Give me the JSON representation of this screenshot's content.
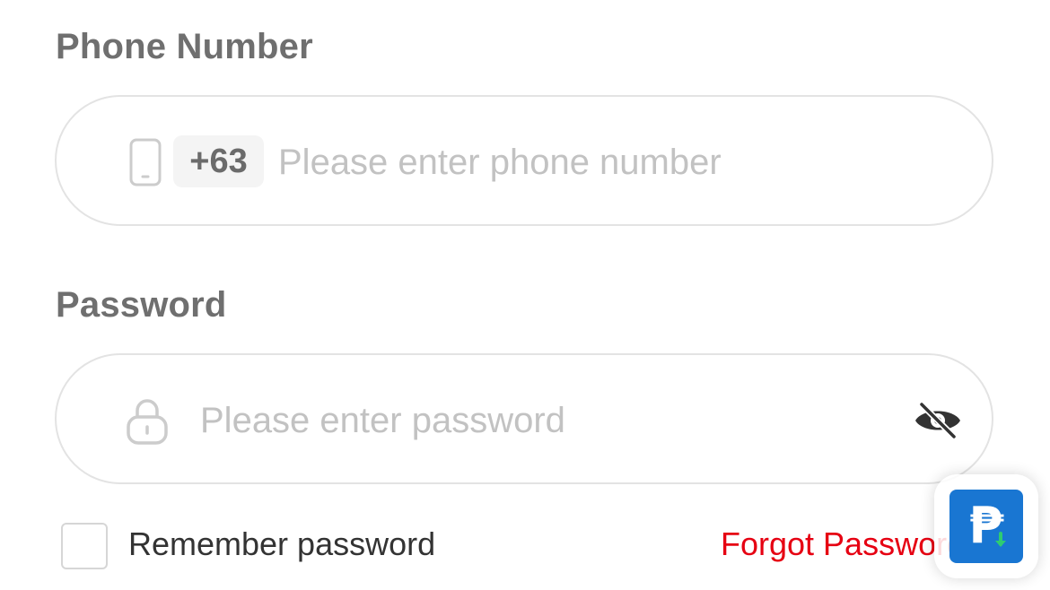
{
  "phone": {
    "label": "Phone Number",
    "country_code": "+63",
    "placeholder": "Please enter phone number",
    "value": "",
    "icon": "mobile-phone-icon"
  },
  "password": {
    "label": "Password",
    "placeholder": "Please enter password",
    "value": "",
    "icon": "lock-icon",
    "toggle_icon": "eye-slash-icon"
  },
  "remember": {
    "label": "Remember password",
    "checked": false
  },
  "forgot": {
    "label": "Forgot Password ?"
  },
  "floating_button": {
    "glyph": "₱",
    "icon": "peso-download-icon"
  },
  "colors": {
    "label_gray": "#6f6f6f",
    "placeholder_gray": "#c2c2c2",
    "border_gray": "#e3e3e3",
    "link_red": "#e60012",
    "float_blue": "#1976d2",
    "arrow_green": "#2ecc71"
  }
}
